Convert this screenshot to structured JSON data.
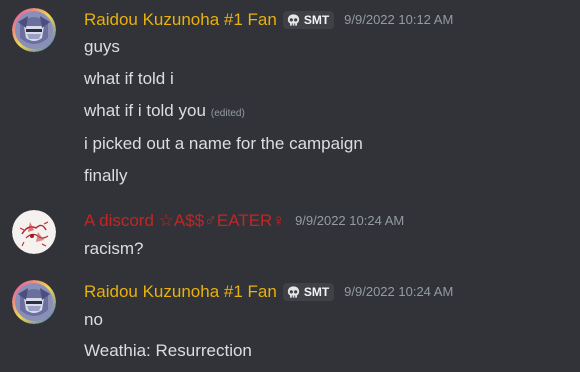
{
  "colors": {
    "background": "#313338",
    "username_gold": "#e8b10c",
    "username_red": "#c32525",
    "text": "#dbdee1",
    "timestamp": "#949ba4",
    "tag_bg": "#3f4147"
  },
  "messages": [
    {
      "avatar_icon": "masked-character-avatar-icon",
      "username": "Raidou Kuzunoha #1 Fan",
      "tag": "SMT",
      "tag_icon": "skull-icon",
      "timestamp": "9/9/2022 10:12 AM",
      "lines": [
        {
          "text": "guys"
        },
        {
          "text": "what if told i"
        },
        {
          "text": "what if i told you",
          "edited": "(edited)"
        },
        {
          "text": "i picked out a name for the campaign"
        },
        {
          "text": "finally"
        }
      ]
    },
    {
      "avatar_icon": "red-sketch-avatar-icon",
      "username": "A discord ☆A$$♂EATER♀",
      "timestamp": "9/9/2022 10:24 AM",
      "lines": [
        {
          "text": "racism?"
        }
      ]
    },
    {
      "avatar_icon": "masked-character-avatar-icon",
      "username": "Raidou Kuzunoha #1 Fan",
      "tag": "SMT",
      "tag_icon": "skull-icon",
      "timestamp": "9/9/2022 10:24 AM",
      "lines": [
        {
          "text": "no"
        },
        {
          "text": "Weathia: Resurrection"
        }
      ]
    }
  ]
}
